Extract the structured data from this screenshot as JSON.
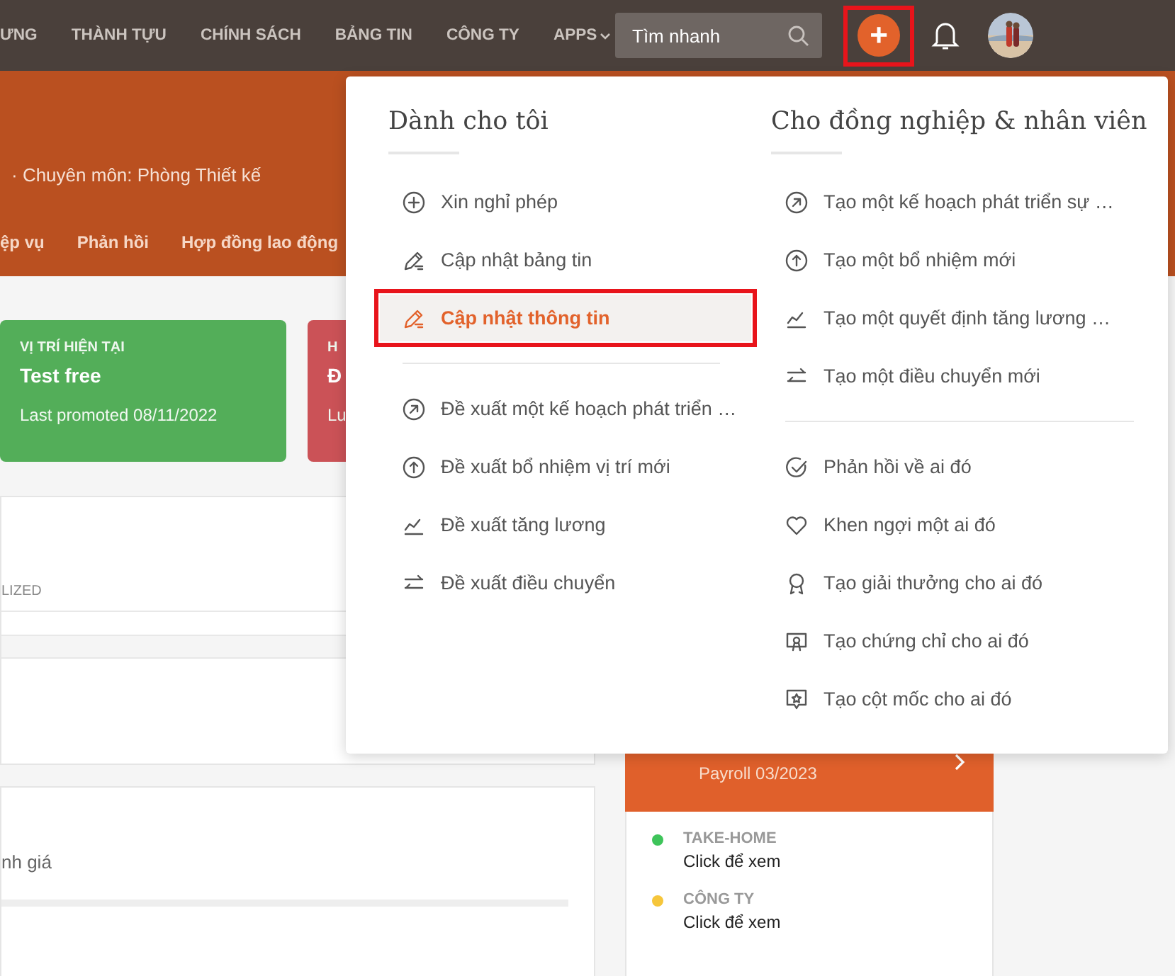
{
  "nav": {
    "items": [
      "ƯNG",
      "THÀNH TỰU",
      "CHÍNH SÁCH",
      "BẢNG TIN",
      "CÔNG TY"
    ],
    "apps_menu": {
      "label": "APPS"
    },
    "search": {
      "placeholder": "Tìm nhanh"
    },
    "add_button": {
      "label": "+",
      "highlighted": true
    }
  },
  "banner": {
    "subtitle": "· Chuyên môn: Phòng Thiết kế",
    "tabs": [
      "ệp vụ",
      "Phản hồi",
      "Hợp đồng lao động"
    ]
  },
  "status_cards": [
    {
      "label": "VỊ TRÍ HIỆN TẠI",
      "title": "Test free",
      "note": "Last promoted 08/11/2022",
      "color": "#53ae59"
    },
    {
      "label": "H",
      "title": "Đ",
      "note": "Lu",
      "color": "#cb5257"
    }
  ],
  "table_panel": {
    "column_header": "LIZED"
  },
  "review_panel": {
    "text": "nh giá"
  },
  "payroll": {
    "subtitle": "Payroll 03/2023",
    "entries": [
      {
        "label": "TAKE-HOME",
        "value": "Click để xem",
        "color": "#3ec45a"
      },
      {
        "label": "CÔNG TY",
        "value": "Click để xem",
        "color": "#f6c63b"
      }
    ]
  },
  "quick_menu": {
    "columns": [
      {
        "heading": "Dành cho tôi",
        "groups": [
          [
            {
              "label": "Xin nghỉ phép",
              "kind": "plus",
              "selected": false,
              "highlighted": false
            },
            {
              "label": "Cập nhật bảng tin",
              "kind": "pencil",
              "selected": false,
              "highlighted": false
            },
            {
              "label": "Cập nhật thông tin",
              "kind": "pencil",
              "selected": true,
              "highlighted": true
            }
          ],
          [
            {
              "label": "Đề xuất một kế hoạch phát triển …",
              "kind": "arrow-diagonal",
              "selected": false,
              "highlighted": false
            },
            {
              "label": "Đề xuất bổ nhiệm vị trí mới",
              "kind": "arrow-up",
              "selected": false,
              "highlighted": false
            },
            {
              "label": "Đề xuất tăng lương",
              "kind": "chart",
              "selected": false,
              "highlighted": false
            },
            {
              "label": "Đề xuất điều chuyển",
              "kind": "swap",
              "selected": false,
              "highlighted": false
            }
          ]
        ]
      },
      {
        "heading": "Cho đồng nghiệp & nhân viên",
        "groups": [
          [
            {
              "label": "Tạo một kế hoạch phát triển sự …",
              "kind": "arrow-diagonal",
              "selected": false,
              "highlighted": false
            },
            {
              "label": "Tạo một bổ nhiệm mới",
              "kind": "arrow-up",
              "selected": false,
              "highlighted": false
            },
            {
              "label": "Tạo một quyết định tăng lương …",
              "kind": "chart",
              "selected": false,
              "highlighted": false
            },
            {
              "label": "Tạo một điều chuyển mới",
              "kind": "swap",
              "selected": false,
              "highlighted": false
            }
          ],
          [
            {
              "label": "Phản hồi về ai đó",
              "kind": "check",
              "selected": false,
              "highlighted": false
            },
            {
              "label": "Khen ngợi một ai đó",
              "kind": "heart",
              "selected": false,
              "highlighted": false
            },
            {
              "label": "Tạo giải thưởng cho ai đó",
              "kind": "award",
              "selected": false,
              "highlighted": false
            },
            {
              "label": "Tạo chứng chỉ cho ai đó",
              "kind": "certificate",
              "selected": false,
              "highlighted": false
            },
            {
              "label": "Tạo cột mốc cho ai đó",
              "kind": "milestone",
              "selected": false,
              "highlighted": false
            }
          ]
        ]
      }
    ]
  }
}
